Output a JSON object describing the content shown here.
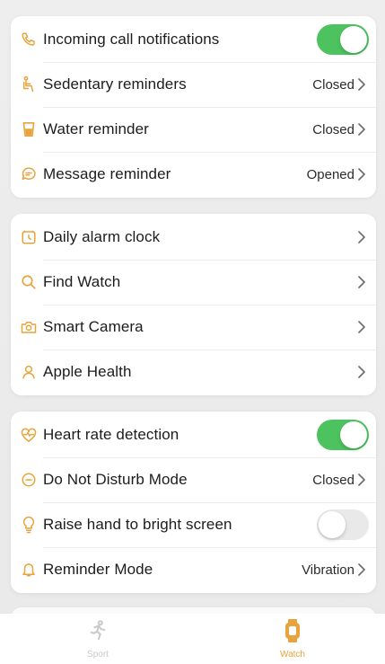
{
  "colors": {
    "accent": "#e8a33c",
    "toggle_on": "#4cc35e",
    "toggle_off": "#e9e9ea",
    "icon": "#e8a33c"
  },
  "section1": {
    "items": [
      {
        "label": "Incoming call notifications",
        "icon": "phone-icon",
        "control": "toggle",
        "state": "on"
      },
      {
        "label": "Sedentary reminders",
        "icon": "sedentary-icon",
        "value": "Closed"
      },
      {
        "label": "Water reminder",
        "icon": "water-cup-icon",
        "value": "Closed"
      },
      {
        "label": "Message reminder",
        "icon": "message-icon",
        "value": "Opened"
      }
    ]
  },
  "section2": {
    "items": [
      {
        "label": "Daily alarm clock",
        "icon": "alarm-clock-icon"
      },
      {
        "label": "Find Watch",
        "icon": "search-icon"
      },
      {
        "label": "Smart Camera",
        "icon": "camera-icon"
      },
      {
        "label": "Apple Health",
        "icon": "person-icon"
      }
    ]
  },
  "section3": {
    "items": [
      {
        "label": "Heart rate detection",
        "icon": "heart-icon",
        "control": "toggle",
        "state": "on"
      },
      {
        "label": "Do Not Disturb Mode",
        "icon": "do-not-disturb-icon",
        "value": "Closed"
      },
      {
        "label": "Raise hand to bright screen",
        "icon": "lightbulb-icon",
        "control": "toggle",
        "state": "off"
      },
      {
        "label": "Reminder Mode",
        "icon": "bell-icon",
        "value": "Vibration"
      }
    ]
  },
  "tabbar": {
    "tabs": [
      {
        "label": "Sport",
        "icon": "running-icon",
        "active": false
      },
      {
        "label": "Watch",
        "icon": "watch-icon",
        "active": true
      }
    ]
  }
}
